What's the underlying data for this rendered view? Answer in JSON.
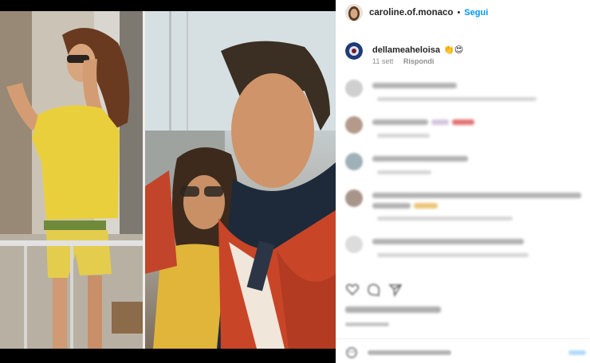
{
  "post": {
    "username": "caroline.of.monaco",
    "separator": "•",
    "follow_label": "Segui"
  },
  "comments": [
    {
      "username": "dellameaheloisa",
      "text": "👏😍",
      "time": "11 sett",
      "reply_label": "Rispondi"
    }
  ],
  "icons": {
    "avatar": "profile-avatar",
    "like": "heart-icon",
    "comment": "comment-icon",
    "share": "paper-plane-icon",
    "emoji": "emoji-icon"
  },
  "colors": {
    "link": "#0095f6",
    "text": "#262626",
    "muted": "#8e8e8e"
  }
}
